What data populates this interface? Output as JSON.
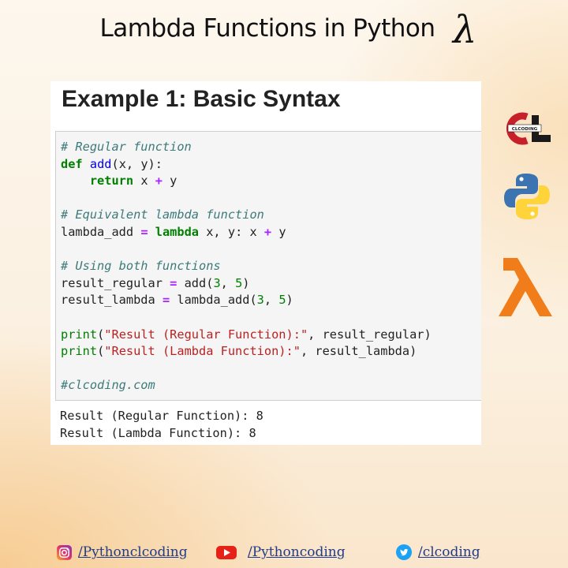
{
  "header": {
    "title": "Lambda Functions in Python",
    "symbol": "λ"
  },
  "card": {
    "heading": "Example 1: Basic Syntax",
    "code_lines": [
      [
        {
          "t": "# Regular function",
          "c": "cm"
        }
      ],
      [
        {
          "t": "def",
          "c": "kw"
        },
        {
          "t": " "
        },
        {
          "t": "add",
          "c": "fn"
        },
        {
          "t": "(x, y):"
        }
      ],
      [
        {
          "t": "    "
        },
        {
          "t": "return",
          "c": "kw"
        },
        {
          "t": " x "
        },
        {
          "t": "+",
          "c": "op"
        },
        {
          "t": " y"
        }
      ],
      [],
      [
        {
          "t": "# Equivalent lambda function",
          "c": "cm"
        }
      ],
      [
        {
          "t": "lambda_add "
        },
        {
          "t": "=",
          "c": "op"
        },
        {
          "t": " "
        },
        {
          "t": "lambda",
          "c": "kw"
        },
        {
          "t": " x, y: x "
        },
        {
          "t": "+",
          "c": "op"
        },
        {
          "t": " y"
        }
      ],
      [],
      [
        {
          "t": "# Using both functions",
          "c": "cm"
        }
      ],
      [
        {
          "t": "result_regular "
        },
        {
          "t": "=",
          "c": "op"
        },
        {
          "t": " add("
        },
        {
          "t": "3",
          "c": "num"
        },
        {
          "t": ", "
        },
        {
          "t": "5",
          "c": "num"
        },
        {
          "t": ")"
        }
      ],
      [
        {
          "t": "result_lambda "
        },
        {
          "t": "=",
          "c": "op"
        },
        {
          "t": " lambda_add("
        },
        {
          "t": "3",
          "c": "num"
        },
        {
          "t": ", "
        },
        {
          "t": "5",
          "c": "num"
        },
        {
          "t": ")"
        }
      ],
      [],
      [
        {
          "t": "print",
          "c": "kw2"
        },
        {
          "t": "("
        },
        {
          "t": "\"Result (Regular Function):\"",
          "c": "str"
        },
        {
          "t": ", result_regular)"
        }
      ],
      [
        {
          "t": "print",
          "c": "kw2"
        },
        {
          "t": "("
        },
        {
          "t": "\"Result (Lambda Function):\"",
          "c": "str"
        },
        {
          "t": ", result_lambda)"
        }
      ],
      [],
      [
        {
          "t": "#clcoding.com",
          "c": "cm"
        }
      ]
    ],
    "output_lines": [
      "Result (Regular Function): 8",
      "Result (Lambda Function): 8"
    ]
  },
  "side_logos": {
    "clcoding_text": "CLCODING",
    "clcoding_letters": "CL",
    "lambda_symbol": "λ",
    "colors": {
      "clcoding_red": "#c8202b",
      "python_blue": "#3b74b0",
      "python_yellow": "#ffd43b",
      "lambda_orange": "#f07d1a"
    }
  },
  "footer": {
    "instagram": "/Pythonclcoding",
    "youtube": "/Pythoncoding",
    "twitter": "/clcoding"
  }
}
